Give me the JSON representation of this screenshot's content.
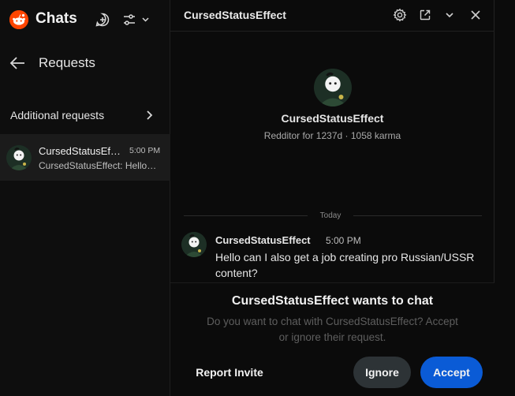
{
  "sidebar": {
    "title": "Chats",
    "section_title": "Requests",
    "additional_requests_label": "Additional requests",
    "items": [
      {
        "name": "CursedStatusEffect",
        "time": "5:00 PM",
        "preview": "CursedStatusEffect: Hello can I also get a job creating pro Russian/USSR content?"
      }
    ]
  },
  "chat": {
    "title": "CursedStatusEffect",
    "profile": {
      "name": "CursedStatusEffect",
      "meta": "Redditor for 1237d · 1058 karma"
    },
    "divider_label": "Today",
    "messages": [
      {
        "author": "CursedStatusEffect",
        "time": "5:00 PM",
        "text": "Hello can I also get a job creating pro Russian/USSR content?"
      }
    ]
  },
  "request": {
    "title": "CursedStatusEffect wants to chat",
    "body": "Do you want to chat with CursedStatusEffect? Accept or ignore their request.",
    "report_label": "Report Invite",
    "ignore_label": "Ignore",
    "accept_label": "Accept"
  },
  "icons": {
    "logo": "reddit-logo-icon",
    "new_chat": "new-chat-icon",
    "filter": "filter-icon",
    "back": "back-arrow-icon",
    "settings": "gear-icon",
    "popout": "popout-icon",
    "collapse": "chevron-down-icon",
    "close": "close-icon"
  },
  "colors": {
    "brand": "#ff4500",
    "accept": "#0a5bd6",
    "ignore": "#2d3336"
  }
}
